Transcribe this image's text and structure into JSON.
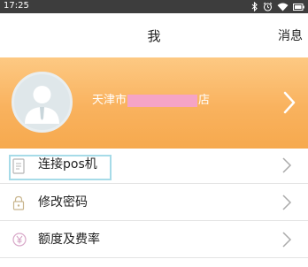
{
  "status_bar": {
    "time": "17:25",
    "icons": [
      "bluetooth-icon",
      "alarm-icon",
      "wifi-icon",
      "battery-icon"
    ]
  },
  "header": {
    "title": "我",
    "action": "消息"
  },
  "profile": {
    "store_prefix": "天津市",
    "store_suffix": "店",
    "avatar": "default-user-avatar"
  },
  "menu": {
    "items": [
      {
        "label": "连接pos机",
        "icon": "document-icon"
      },
      {
        "label": "修改密码",
        "icon": "lock-icon"
      },
      {
        "label": "额度及费率",
        "icon": "yen-icon"
      }
    ]
  },
  "colors": {
    "banner": "#f9b25e",
    "redaction": "#f5a4c5",
    "focus_outline": "#a6dbe8"
  }
}
